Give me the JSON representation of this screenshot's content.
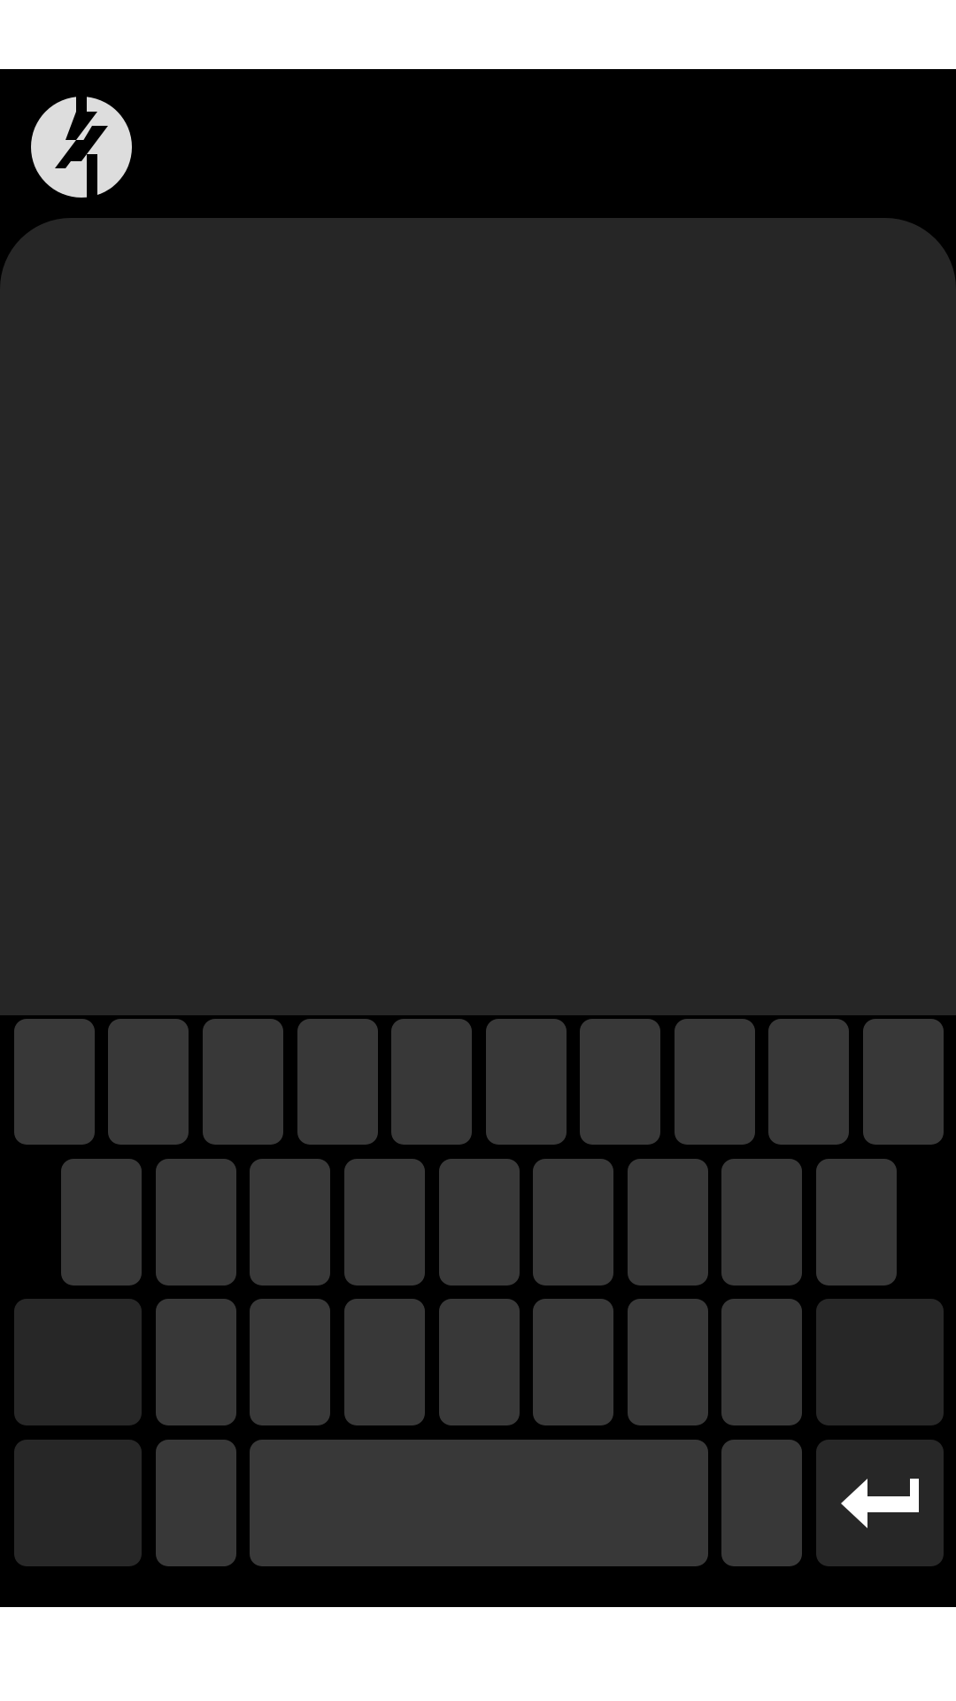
{
  "app": {
    "logo_icon": "twrp-logo-icon"
  },
  "colors": {
    "background": "#000000",
    "panel": "#262626",
    "key": "#383838",
    "function_key": "#272727",
    "logo": "#dddddd"
  },
  "keyboard": {
    "row1_keys": 10,
    "row2_keys": 9,
    "row3_letter_keys": 7,
    "enter_icon": "enter-arrow-icon"
  }
}
